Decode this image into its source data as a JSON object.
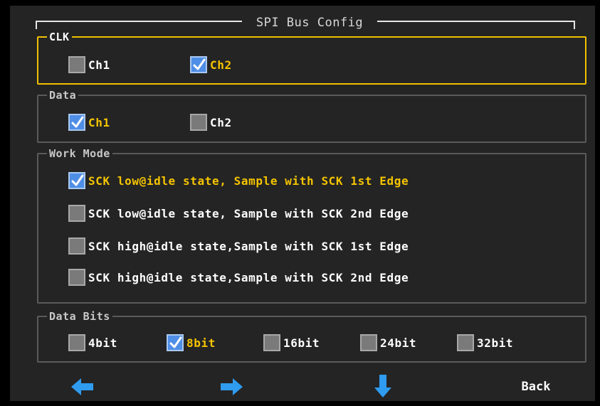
{
  "title": "SPI Bus Config",
  "groups": {
    "clk": {
      "label": "CLK",
      "options": [
        {
          "label": "Ch1",
          "checked": false
        },
        {
          "label": "Ch2",
          "checked": true
        }
      ]
    },
    "data": {
      "label": "Data",
      "options": [
        {
          "label": "Ch1",
          "checked": true
        },
        {
          "label": "Ch2",
          "checked": false
        }
      ]
    },
    "work_mode": {
      "label": "Work Mode",
      "options": [
        {
          "label": "SCK low@idle state, Sample with SCK 1st Edge",
          "checked": true
        },
        {
          "label": "SCK low@idle state, Sample with SCK 2nd Edge",
          "checked": false
        },
        {
          "label": "SCK high@idle state,Sample with SCK 1st Edge",
          "checked": false
        },
        {
          "label": "SCK high@idle state,Sample with SCK 2nd Edge",
          "checked": false
        }
      ]
    },
    "data_bits": {
      "label": "Data Bits",
      "options": [
        {
          "label": "4bit",
          "checked": false
        },
        {
          "label": "8bit",
          "checked": true
        },
        {
          "label": "16bit",
          "checked": false
        },
        {
          "label": "24bit",
          "checked": false
        },
        {
          "label": "32bit",
          "checked": false
        }
      ]
    }
  },
  "footer": {
    "left_icon": "arrow-left-icon",
    "right_icon": "arrow-right-icon",
    "down_icon": "arrow-down-icon",
    "back_label": "Back"
  },
  "colors": {
    "accent": "#f5c400",
    "check_fill": "#4f8ee6",
    "nav_arrow": "#2f9cf0"
  }
}
